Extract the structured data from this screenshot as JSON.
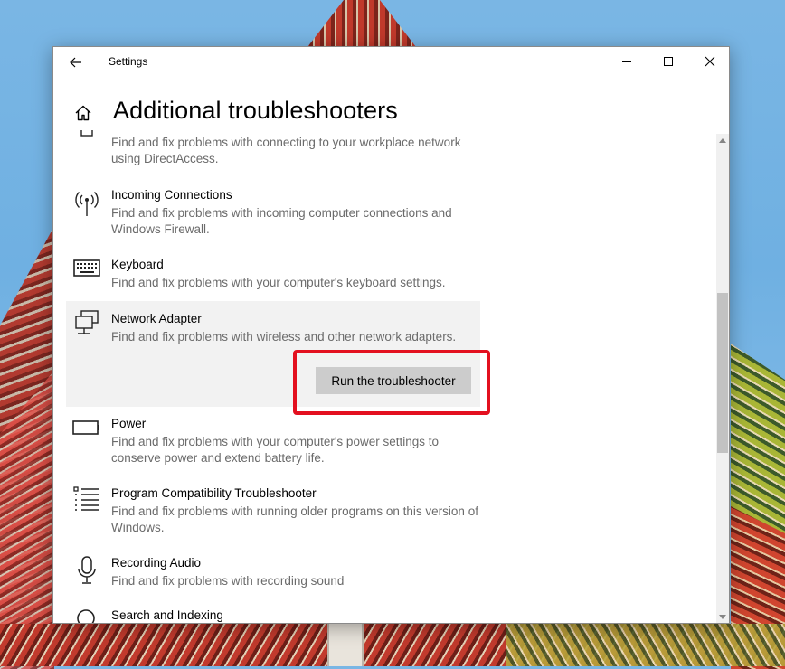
{
  "window": {
    "title": "Settings",
    "controls": {
      "minimize": "minimize-icon",
      "maximize": "maximize-icon",
      "close": "close-icon"
    }
  },
  "page": {
    "title": "Additional troubleshooters"
  },
  "items": [
    {
      "name": "",
      "description": "Find and fix problems with connecting to your workplace network using DirectAccess.",
      "icon": "directaccess-icon"
    },
    {
      "name": "Incoming Connections",
      "description": "Find and fix problems with incoming computer connections and Windows Firewall.",
      "icon": "antenna-icon"
    },
    {
      "name": "Keyboard",
      "description": "Find and fix problems with your computer's keyboard settings.",
      "icon": "keyboard-icon"
    },
    {
      "name": "Network Adapter",
      "description": "Find and fix problems with wireless and other network adapters.",
      "icon": "network-adapter-icon",
      "button": "Run the troubleshooter"
    },
    {
      "name": "Power",
      "description": "Find and fix problems with your computer's power settings to conserve power and extend battery life.",
      "icon": "battery-icon"
    },
    {
      "name": "Program Compatibility Troubleshooter",
      "description": "Find and fix problems with running older programs on this version of Windows.",
      "icon": "list-icon"
    },
    {
      "name": "Recording Audio",
      "description": "Find and fix problems with recording sound",
      "icon": "microphone-icon"
    },
    {
      "name": "Search and Indexing",
      "description": "",
      "icon": "search-icon"
    }
  ],
  "colors": {
    "highlight": "#e3101f",
    "selected_bg": "#f2f2f2",
    "button_bg": "#cccccc"
  }
}
